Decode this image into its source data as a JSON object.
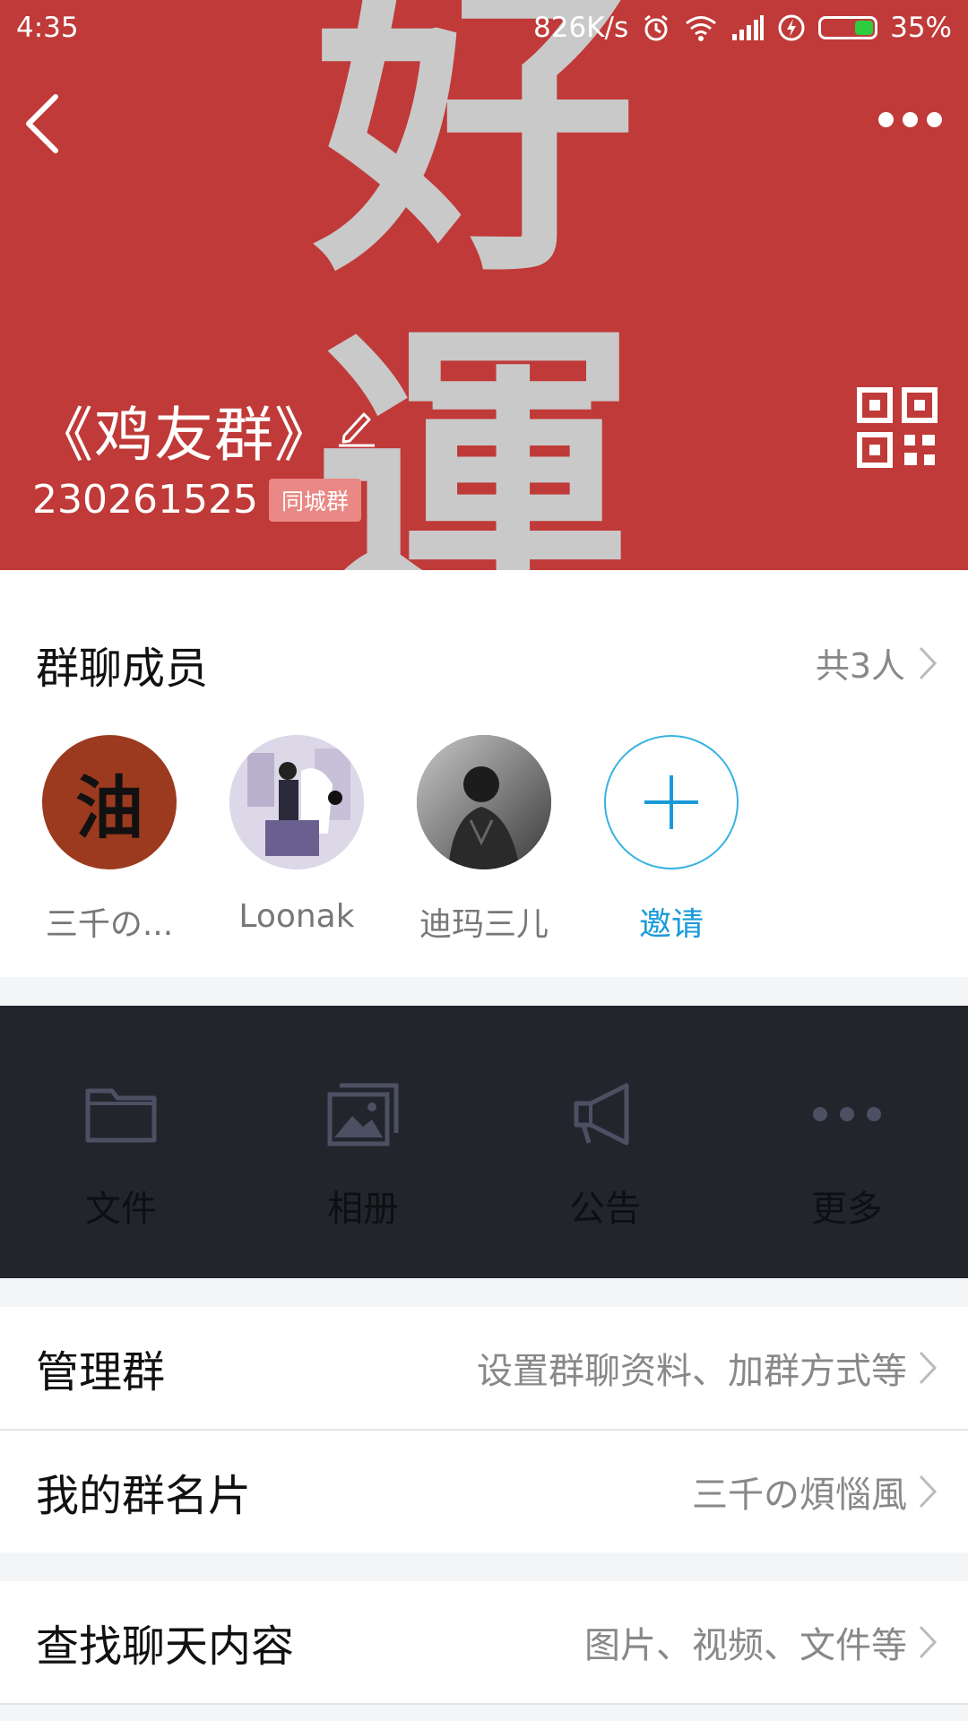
{
  "status_bar": {
    "time": "4:35",
    "net_speed": "826K/s",
    "battery": "35%",
    "icons": [
      "alarm-icon",
      "wifi-icon",
      "signal-icon",
      "charging-icon",
      "battery-icon"
    ]
  },
  "header": {
    "background_art": [
      "好",
      "運"
    ],
    "title": "《鸡友群》",
    "group_id": "230261525",
    "tag": "同城群",
    "colors": {
      "background": "#bf3a38",
      "tag": "#e98884"
    }
  },
  "members": {
    "heading": "群聊成员",
    "count_label": "共3人",
    "list": [
      {
        "name": "三千の...",
        "avatar_text": "油"
      },
      {
        "name": "Loonak"
      },
      {
        "name": "迪玛三儿"
      }
    ],
    "invite_label": "邀请",
    "invite_color": "#1a9bd9"
  },
  "actions": [
    {
      "label": "文件",
      "icon": "folder-icon"
    },
    {
      "label": "相册",
      "icon": "album-icon"
    },
    {
      "label": "公告",
      "icon": "megaphone-icon"
    },
    {
      "label": "更多",
      "icon": "more-dots-icon"
    }
  ],
  "rows": {
    "manage": {
      "title": "管理群",
      "value": "设置群聊资料、加群方式等"
    },
    "card": {
      "title": "我的群名片",
      "value": "三千の煩惱風"
    },
    "search": {
      "title": "查找聊天内容",
      "value": "图片、视频、文件等"
    }
  }
}
